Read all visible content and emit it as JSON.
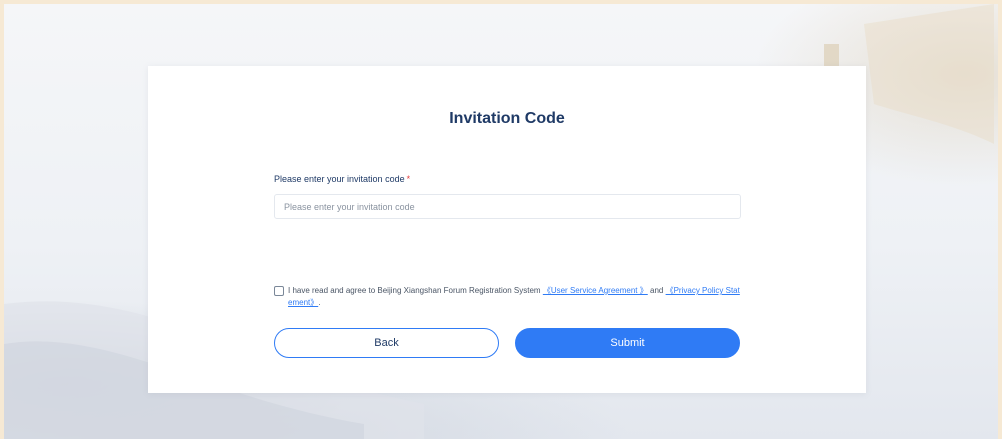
{
  "form": {
    "title": "Invitation Code",
    "field_label": "Please enter your invitation code",
    "required_mark": "*",
    "input_value": "",
    "input_placeholder": "Please enter your invitation code"
  },
  "agreement": {
    "text": "I have read and agree to Beijing Xiangshan Forum Registration System",
    "link_user_service": "《User Service Agreement 》",
    "conjunction": "and",
    "link_privacy": "《Privacy Policy Statement》",
    "trailing": "."
  },
  "buttons": {
    "back_label": "Back",
    "submit_label": "Submit"
  },
  "colors": {
    "accent": "#2f7bf5",
    "title_text": "#1f3a66",
    "required": "#e23b3b",
    "page_border": "#f6e9d4"
  }
}
